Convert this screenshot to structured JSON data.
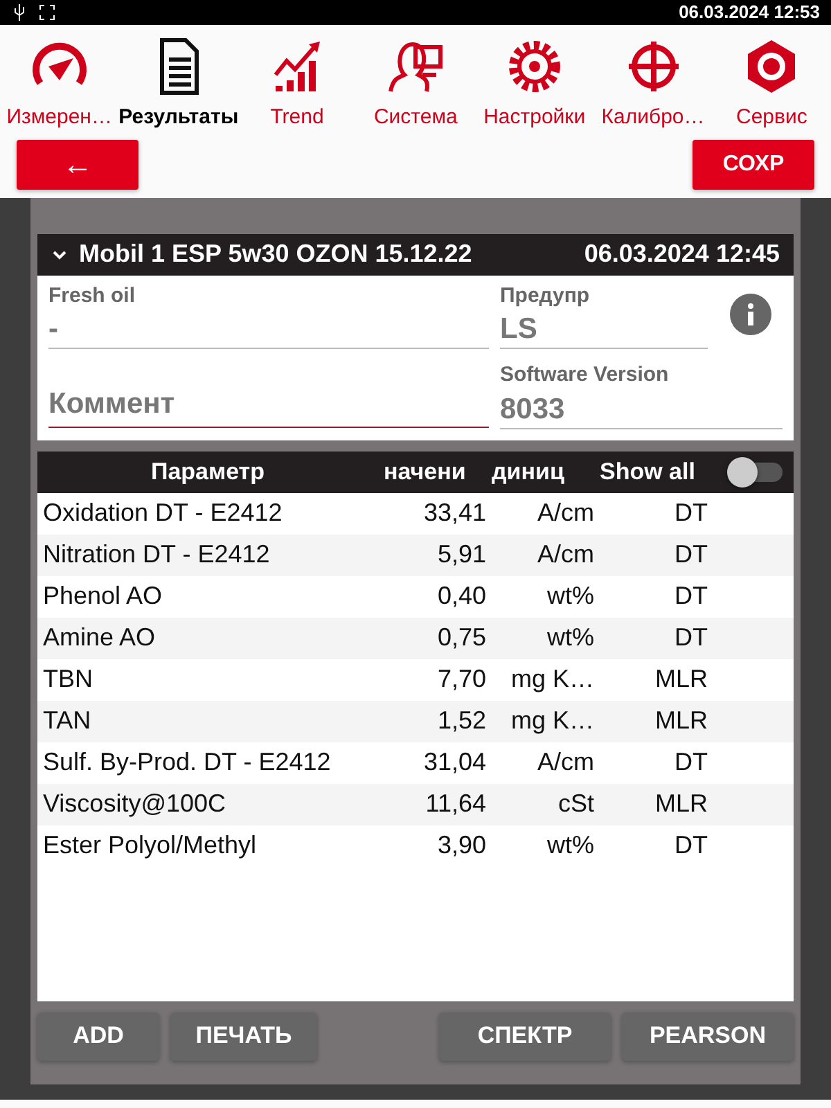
{
  "status_bar": {
    "datetime": "06.03.2024 12:53"
  },
  "nav": [
    {
      "label": "Измерен…",
      "selected": false
    },
    {
      "label": "Результаты",
      "selected": true
    },
    {
      "label": "Trend",
      "selected": false
    },
    {
      "label": "Система",
      "selected": false
    },
    {
      "label": "Настройки",
      "selected": false
    },
    {
      "label": "Калибро…",
      "selected": false
    },
    {
      "label": "Сервис",
      "selected": false
    }
  ],
  "actions": {
    "back": "←",
    "save": "СОХР"
  },
  "sample": {
    "title": "Mobil 1 ESP 5w30 OZON 15.12.22",
    "date": "06.03.2024 12:45",
    "expanded": true,
    "fields": [
      {
        "label": "Fresh oil",
        "value": "-"
      },
      {
        "label": "Предупр",
        "value": "LS"
      },
      {
        "label": "Software Version",
        "value": "8033"
      }
    ],
    "comment": {
      "placeholder": "Коммент"
    }
  },
  "table": {
    "columns": [
      "Параметр",
      "начени",
      "диниц"
    ],
    "show_all": {
      "label": "Show all",
      "on": false
    },
    "rows": [
      {
        "parameter": "Oxidation DT - E2412",
        "value": "33,41",
        "unit": "A/cm",
        "method": "DT"
      },
      {
        "parameter": "Nitration DT - E2412",
        "value": "5,91",
        "unit": "A/cm",
        "method": "DT"
      },
      {
        "parameter": "Phenol AO",
        "value": "0,40",
        "unit": "wt%",
        "method": "DT"
      },
      {
        "parameter": "Amine AO",
        "value": "0,75",
        "unit": "wt%",
        "method": "DT"
      },
      {
        "parameter": "TBN",
        "value": "7,70",
        "unit": "mg K…",
        "method": "MLR"
      },
      {
        "parameter": "TAN",
        "value": "1,52",
        "unit": "mg K…",
        "method": "MLR"
      },
      {
        "parameter": "Sulf. By-Prod. DT - E2412",
        "value": "31,04",
        "unit": "A/cm",
        "method": "DT"
      },
      {
        "parameter": "Viscosity@100C",
        "value": "11,64",
        "unit": "cSt",
        "method": "MLR"
      },
      {
        "parameter": "Ester Polyol/Methyl",
        "value": "3,90",
        "unit": "wt%",
        "method": "DT"
      }
    ]
  },
  "bottom_buttons": [
    "ADD",
    "ПЕЧАТЬ",
    "СПЕКТР",
    "PEARSON"
  ]
}
